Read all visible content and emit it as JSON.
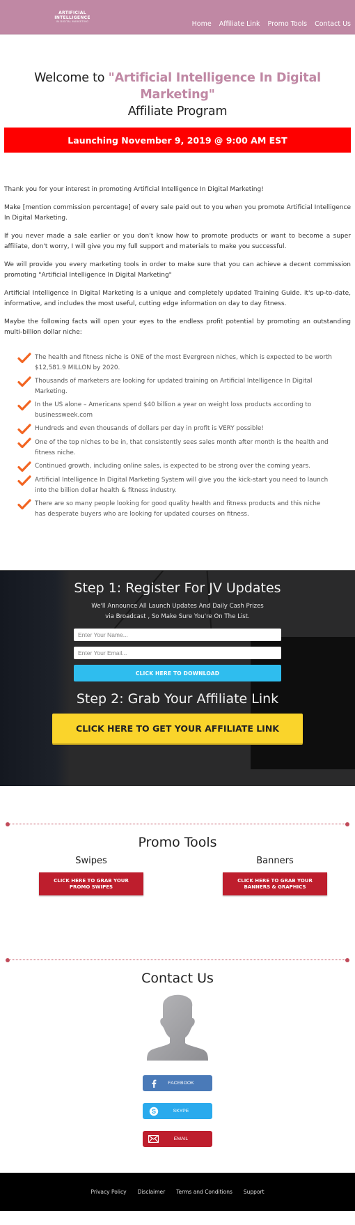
{
  "header": {
    "logo": {
      "line1": "ARTIFICIAL",
      "line2": "INTELLIGENCE",
      "line3": "IN DIGITAL MARKETING"
    },
    "nav": [
      {
        "label": "Home"
      },
      {
        "label": "Affiliate Link"
      },
      {
        "label": "Promo Tools"
      },
      {
        "label": "Contact Us"
      }
    ]
  },
  "welcome": {
    "prefix": "Welcome to ",
    "product": "\"Artificial Intelligence In Digital Marketing\"",
    "suffix": "Affiliate Program",
    "launch_banner": "Launching November 9, 2019 @ 9:00 AM EST"
  },
  "intro": {
    "paragraphs": [
      "Thank you for your interest in promoting Artificial Intelligence In Digital Marketing!",
      "Make [mention commission percentage] of every sale paid out to you when you promote Artificial Intelligence In Digital Marketing.",
      "If you never made a sale earlier or you don't know how to promote products or want to become a super affiliate, don't worry, I will give you my full support and materials to make you successful.",
      "We will provide you every marketing tools in order to make sure that you can achieve a decent commission promoting \"Artificial Intelligence In Digital Marketing\"",
      "Artificial Intelligence In Digital Marketing is a unique and completely updated Training Guide. it's up-to-date, informative, and includes the most useful, cutting edge information on day to day fitness.",
      "Maybe the following facts will open your eyes to the endless profit potential by promoting an outstanding multi-billion dollar niche:"
    ]
  },
  "facts": [
    "The health and fitness niche is ONE of the most Evergreen niches, which is expected to be worth $12,581.9 MILLON by 2020.",
    "Thousands of marketers are looking for updated training on Artificial Intelligence In Digital Marketing.",
    "In the US alone – Americans spend $40 billion a year on weight loss products according to businessweek.com",
    "Hundreds and even thousands of dollars per day in profit is VERY possible!",
    "One of the top niches to be in, that consistently sees sales month after month is the health and fitness niche.",
    "Continued growth, including online sales, is expected to be strong over the coming years.",
    "Artificial Intelligence In Digital Marketing System will give you the kick-start you need to launch into the billion dollar health & fitness industry.",
    "There are so many people looking for good quality health and fitness products and this niche has desperate buyers who are looking for updated courses on fitness."
  ],
  "jv": {
    "step1_title": "Step 1: Register For JV Updates",
    "step1_sub_line1": "We'll Announce All Launch Updates And Daily Cash Prizes",
    "step1_sub_line2": "via Broadcast , So Make Sure You're On The List.",
    "name_placeholder": "Enter Your Name...",
    "email_placeholder": "Enter Your Email...",
    "name_value": "",
    "email_value": "",
    "download_button": "CLICK HERE TO DOWNLOAD",
    "step2_title": "Step 2: Grab Your Affiliate Link",
    "affiliate_button": "CLICK HERE TO GET YOUR AFFILIATE LINK"
  },
  "promo": {
    "title": "Promo Tools",
    "swipes": {
      "heading": "Swipes",
      "button": "CLICK HERE TO GRAB YOUR PROMO SWIPES"
    },
    "banners": {
      "heading": "Banners",
      "button": "CLICK HERE TO GRAB YOUR BANNERS & GRAPHICS"
    }
  },
  "contact": {
    "title": "Contact Us",
    "avatar_icon": "person-silhouette-icon",
    "buttons": [
      {
        "label": "FACEBOOK",
        "icon": "facebook-icon",
        "color": "#4a7ab8"
      },
      {
        "label": "SKYPE",
        "icon": "skype-icon",
        "color": "#2aaaed"
      },
      {
        "label": "EMAIL",
        "icon": "envelope-icon",
        "color": "#be1e2d"
      }
    ]
  },
  "footer": {
    "links": [
      {
        "label": "Privacy Policy"
      },
      {
        "label": "Disclaimer"
      },
      {
        "label": "Terms and Conditions"
      },
      {
        "label": "Support"
      }
    ]
  },
  "colors": {
    "header_bg": "#c088a4",
    "brand_accent": "#c088a4",
    "launch_banner": "#fe0000",
    "check_orange": "#f26522",
    "download_button": "#2fbdee",
    "affiliate_button": "#fad42b",
    "promo_button": "#be1e2d",
    "divider": "#c14b5a"
  }
}
